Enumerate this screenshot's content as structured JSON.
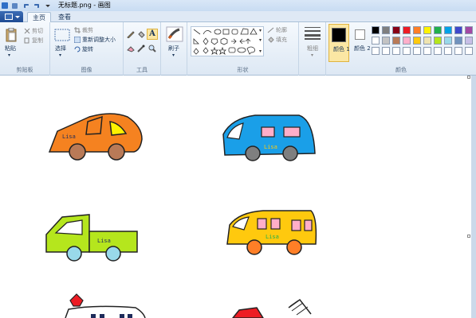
{
  "window": {
    "title": "无标题.png - 画图"
  },
  "tabs": [
    {
      "label": "主页"
    },
    {
      "label": "查看"
    }
  ],
  "clipboard": {
    "paste": "粘贴",
    "cut": "剪切",
    "copy": "复制",
    "group": "剪贴板"
  },
  "image": {
    "select": "选择",
    "crop": "裁剪",
    "resize": "重新调整大小",
    "rotate": "旋转",
    "group": "图像"
  },
  "tools": {
    "group": "工具"
  },
  "brushes": {
    "label": "刷子"
  },
  "shapes": {
    "outline": "轮廓",
    "fill": "填充",
    "group": "形状"
  },
  "size": {
    "label": "粗细"
  },
  "colors": {
    "color1": "颜色 1",
    "color2": "颜色 2",
    "group": "颜色",
    "color1_value": "#000000",
    "color2_value": "#ffffff",
    "palette_row1": [
      "#000000",
      "#7f7f7f",
      "#880015",
      "#ed1c24",
      "#ff7f27",
      "#fff200",
      "#22b14c",
      "#00a2e8",
      "#3f48cc",
      "#a349a4"
    ],
    "palette_row2": [
      "#ffffff",
      "#c3c3c3",
      "#b97a57",
      "#ffaec9",
      "#ffc90e",
      "#efe4b0",
      "#b5e61d",
      "#99d9ea",
      "#7092be",
      "#c8bfe7"
    ],
    "palette_row3": [
      "#ffffff",
      "#ffffff",
      "#ffffff",
      "#ffffff",
      "#ffffff",
      "#ffffff",
      "#ffffff",
      "#ffffff",
      "#ffffff",
      "#ffffff"
    ]
  },
  "drawing": {
    "car_label": "Lisa",
    "vehicles": [
      "orange-car",
      "blue-bus",
      "green-truck",
      "yellow-bus",
      "ambulance",
      "fire-truck"
    ]
  }
}
